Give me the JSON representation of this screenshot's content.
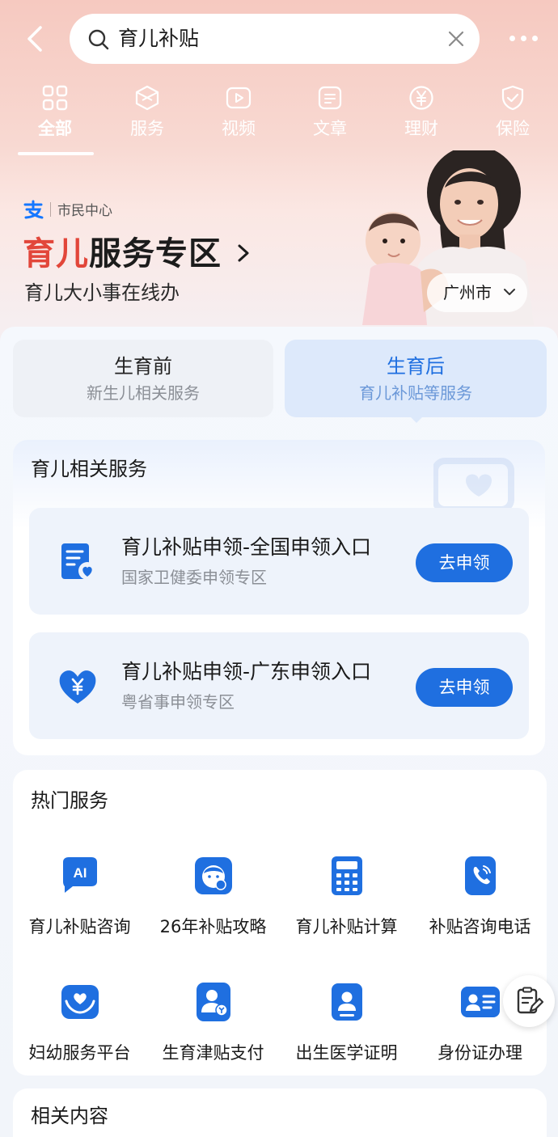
{
  "search": {
    "query": "育儿补贴"
  },
  "tabs": [
    {
      "label": "全部",
      "icon": "grid-icon",
      "active": true
    },
    {
      "label": "服务",
      "icon": "cube-icon"
    },
    {
      "label": "视频",
      "icon": "play-icon"
    },
    {
      "label": "文章",
      "icon": "document-icon"
    },
    {
      "label": "理财",
      "icon": "yen-icon"
    },
    {
      "label": "保险",
      "icon": "shield-check-icon"
    }
  ],
  "hero": {
    "brand_text": "市民中心",
    "title_red": "育儿",
    "title_rest": "服务专区",
    "subtitle": "育儿大小事在线办",
    "city": "广州市"
  },
  "stages": {
    "before": {
      "title": "生育前",
      "sub": "新生儿相关服务"
    },
    "after": {
      "title": "生育后",
      "sub": "育儿补贴等服务"
    }
  },
  "related": {
    "title": "育儿相关服务",
    "items": [
      {
        "title": "育儿补贴申领-全国申领入口",
        "sub": "国家卫健委申领专区",
        "button": "去申领",
        "icon": "form-heart-icon"
      },
      {
        "title": "育儿补贴申领-广东申领入口",
        "sub": "粤省事申领专区",
        "button": "去申领",
        "icon": "heart-yen-icon"
      }
    ]
  },
  "hot": {
    "title": "热门服务",
    "items": [
      {
        "label": "育儿补贴咨询",
        "icon": "ai-chat-icon"
      },
      {
        "label": "26年补贴攻略",
        "icon": "baby-face-icon"
      },
      {
        "label": "育儿补贴计算",
        "icon": "calculator-icon"
      },
      {
        "label": "补贴咨询电话",
        "icon": "phone-icon"
      },
      {
        "label": "妇幼服务平台",
        "icon": "hands-heart-icon"
      },
      {
        "label": "生育津贴支付",
        "icon": "person-money-icon"
      },
      {
        "label": "出生医学证明",
        "icon": "certificate-person-icon"
      },
      {
        "label": "身份证办理",
        "icon": "id-card-icon"
      }
    ]
  },
  "more": {
    "title": "相关内容"
  },
  "colors": {
    "accent": "#1f6fe0",
    "title_red": "#e2463a",
    "top_gradient": "#f6c9c0"
  }
}
